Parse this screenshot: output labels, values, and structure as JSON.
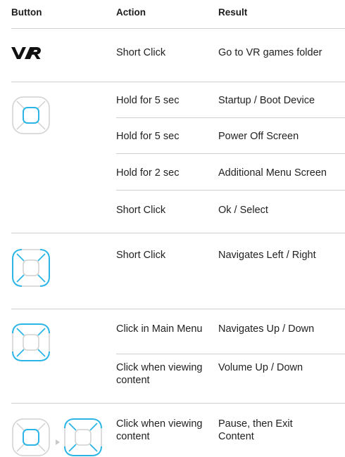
{
  "headers": {
    "button": "Button",
    "action": "Action",
    "result": "Result"
  },
  "sections": [
    {
      "icon": "vr-logo-icon",
      "rows": [
        {
          "action": "Short Click",
          "result": "Go to VR games folder"
        }
      ]
    },
    {
      "icon": "dpad-center-icon",
      "rows": [
        {
          "action": "Hold for 5 sec",
          "result": "Startup / Boot Device"
        },
        {
          "action": "Hold for 5 sec",
          "result": "Power Off Screen"
        },
        {
          "action": "Hold for 2 sec",
          "result": "Additional Menu Screen"
        },
        {
          "action": "Short Click",
          "result": "Ok / Select"
        }
      ]
    },
    {
      "icon": "dpad-left-right-icon",
      "rows": [
        {
          "action": "Short Click",
          "result": "Navigates Left / Right"
        }
      ]
    },
    {
      "icon": "dpad-up-down-icon",
      "rows": [
        {
          "action": "Click in Main Menu",
          "result": "Navigates Up / Down"
        },
        {
          "action": "Click when viewing content",
          "result": "Volume Up / Down"
        }
      ]
    },
    {
      "icon": "dpad-center-then-up-down-icon",
      "rows": [
        {
          "action": "Click when viewing content",
          "result": "Pause, then Exit Content"
        }
      ]
    }
  ],
  "colors": {
    "accent": "#2bb5e6",
    "inactive": "#c9c9c9",
    "text": "#222222",
    "rule": "#cfcfcf"
  }
}
